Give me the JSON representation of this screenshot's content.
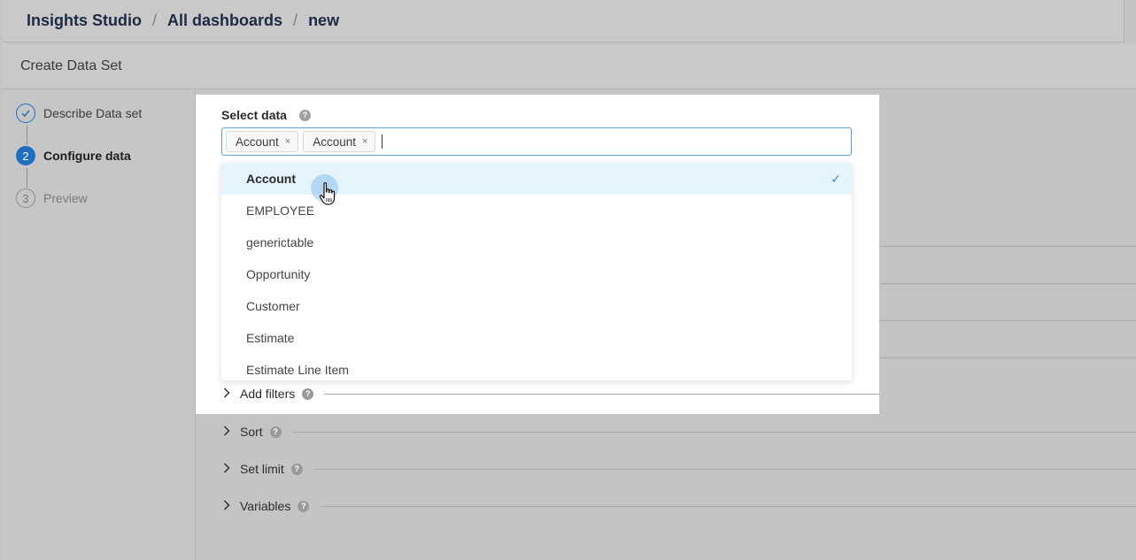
{
  "breadcrumb": {
    "items": [
      "Insights Studio",
      "All dashboards",
      "new"
    ],
    "separator": "/"
  },
  "subheader": {
    "title": "Create Data Set"
  },
  "stepper": {
    "steps": [
      {
        "label": "Describe Data set",
        "number": "1",
        "state": "done"
      },
      {
        "label": "Configure data",
        "number": "2",
        "state": "active"
      },
      {
        "label": "Preview",
        "number": "3",
        "state": "pending"
      }
    ]
  },
  "select_data": {
    "label": "Select data",
    "help": "?",
    "tags": [
      {
        "label": "Account",
        "remove": "×"
      },
      {
        "label": "Account",
        "remove": "×"
      }
    ],
    "options": [
      {
        "label": "Account",
        "selected": true
      },
      {
        "label": "EMPLOYEE",
        "selected": false
      },
      {
        "label": "generictable",
        "selected": false
      },
      {
        "label": "Opportunity",
        "selected": false
      },
      {
        "label": "Customer",
        "selected": false
      },
      {
        "label": "Estimate",
        "selected": false
      },
      {
        "label": "Estimate Line Item",
        "selected": false
      }
    ],
    "check_mark": "✓"
  },
  "sections": {
    "add_filters": "Add filters",
    "sort": "Sort",
    "set_limit": "Set limit",
    "variables": "Variables",
    "chevron": "›",
    "help": "?"
  },
  "colors": {
    "accent": "#1e6fc0",
    "focus_border": "#5aa4e4",
    "selected_row": "#e6f4fd",
    "overlay_bg": "#c4c4c4"
  },
  "icons": {
    "step_done": "check-circle-icon",
    "help": "question-circle-icon",
    "chevron": "chevron-right-icon",
    "tag_remove": "close-icon",
    "selected_check": "checkmark-icon",
    "cursor": "hand-pointer-icon"
  }
}
